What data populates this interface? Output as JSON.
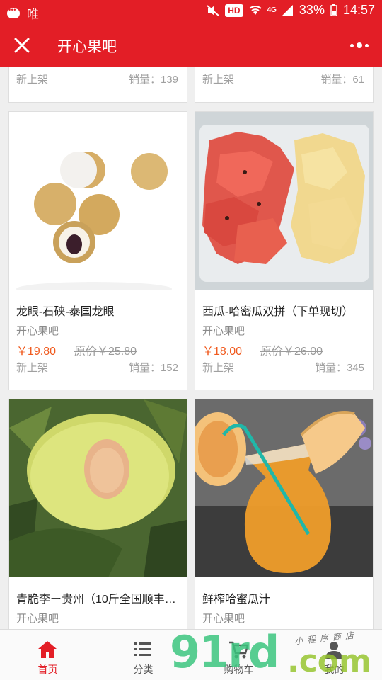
{
  "status_bar": {
    "carrier": "唯",
    "hd_badge": "HD",
    "network": "4G",
    "battery": "33%",
    "time": "14:57"
  },
  "header": {
    "title": "开心果吧"
  },
  "products": [
    {
      "tag": "新上架",
      "sales": "销量：139"
    },
    {
      "tag": "新上架",
      "sales": "销量：61"
    },
    {
      "name": "龙眼-石硖-泰国龙眼",
      "shop": "开心果吧",
      "price": "￥19.80",
      "original_price": "原价￥25.80",
      "tag": "新上架",
      "sales": "销量：152"
    },
    {
      "name": "西瓜-哈密瓜双拼（下单现切）",
      "shop": "开心果吧",
      "price": "￥18.00",
      "original_price": "原价￥26.00",
      "tag": "新上架",
      "sales": "销量：345"
    },
    {
      "name": "青脆李ー贵州（10斤全国顺丰…",
      "shop": "开心果吧"
    },
    {
      "name": "鲜榨哈蜜瓜汁",
      "shop": "开心果吧"
    }
  ],
  "tabbar": {
    "tabs": [
      {
        "label": "首页",
        "icon": "home-icon",
        "active": true
      },
      {
        "label": "分类",
        "icon": "list-icon",
        "active": false
      },
      {
        "label": "购物车",
        "icon": "cart-icon",
        "active": false
      },
      {
        "label": "我的",
        "icon": "user-icon",
        "active": false
      }
    ]
  },
  "watermark": {
    "brand_91": "91",
    "brand_rd": "rd",
    "brand_com": ".com",
    "subtitle": "小程序商店"
  },
  "colors": {
    "brand_red": "#e31e26",
    "price_orange": "#f05a1e",
    "watermark_green": "#3bc47e"
  }
}
